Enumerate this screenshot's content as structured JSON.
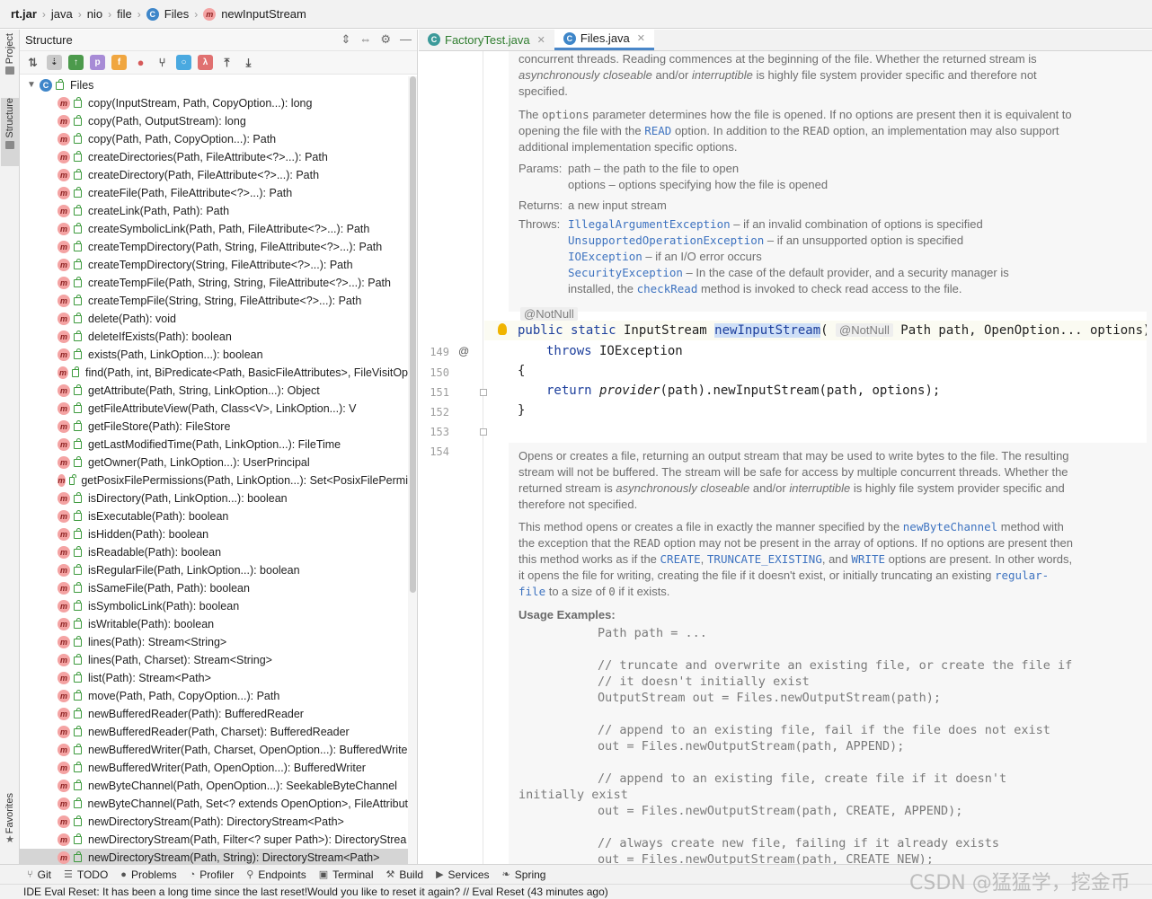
{
  "breadcrumb": [
    "rt.jar",
    "java",
    "nio",
    "file",
    "Files",
    "newInputStream"
  ],
  "left_stripe": {
    "project": "Project",
    "structure": "Structure",
    "favorites": "Favorites"
  },
  "structure": {
    "title": "Structure",
    "root": "Files",
    "members": [
      "copy(InputStream, Path, CopyOption...): long",
      "copy(Path, OutputStream): long",
      "copy(Path, Path, CopyOption...): Path",
      "createDirectories(Path, FileAttribute<?>...): Path",
      "createDirectory(Path, FileAttribute<?>...): Path",
      "createFile(Path, FileAttribute<?>...): Path",
      "createLink(Path, Path): Path",
      "createSymbolicLink(Path, Path, FileAttribute<?>...): Path",
      "createTempDirectory(Path, String, FileAttribute<?>...): Path",
      "createTempDirectory(String, FileAttribute<?>...): Path",
      "createTempFile(Path, String, String, FileAttribute<?>...): Path",
      "createTempFile(String, String, FileAttribute<?>...): Path",
      "delete(Path): void",
      "deleteIfExists(Path): boolean",
      "exists(Path, LinkOption...): boolean",
      "find(Path, int, BiPredicate<Path, BasicFileAttributes>, FileVisitOp",
      "getAttribute(Path, String, LinkOption...): Object",
      "getFileAttributeView(Path, Class<V>, LinkOption...): V",
      "getFileStore(Path): FileStore",
      "getLastModifiedTime(Path, LinkOption...): FileTime",
      "getOwner(Path, LinkOption...): UserPrincipal",
      "getPosixFilePermissions(Path, LinkOption...): Set<PosixFilePermi",
      "isDirectory(Path, LinkOption...): boolean",
      "isExecutable(Path): boolean",
      "isHidden(Path): boolean",
      "isReadable(Path): boolean",
      "isRegularFile(Path, LinkOption...): boolean",
      "isSameFile(Path, Path): boolean",
      "isSymbolicLink(Path): boolean",
      "isWritable(Path): boolean",
      "lines(Path): Stream<String>",
      "lines(Path, Charset): Stream<String>",
      "list(Path): Stream<Path>",
      "move(Path, Path, CopyOption...): Path",
      "newBufferedReader(Path): BufferedReader",
      "newBufferedReader(Path, Charset): BufferedReader",
      "newBufferedWriter(Path, Charset, OpenOption...): BufferedWrite",
      "newBufferedWriter(Path, OpenOption...): BufferedWriter",
      "newByteChannel(Path, OpenOption...): SeekableByteChannel",
      "newByteChannel(Path, Set<? extends OpenOption>, FileAttribut",
      "newDirectoryStream(Path): DirectoryStream<Path>",
      "newDirectoryStream(Path, Filter<? super Path>): DirectoryStrea",
      "newDirectoryStream(Path, String): DirectoryStream<Path>"
    ]
  },
  "editor": {
    "tabs": [
      {
        "name": "FactoryTest.java",
        "active": false
      },
      {
        "name": "Files.java",
        "active": true
      }
    ],
    "doc_top": {
      "p1_a": "concurrent threads. Reading commences at the beginning of the file. Whether the returned stream is ",
      "p1_it1": "asynchronously closeable",
      "p1_b": " and/or ",
      "p1_it2": "interruptible",
      "p1_c": " is highly file system provider specific and therefore not specified.",
      "p2_a": "The ",
      "p2_code": "options",
      "p2_b": " parameter determines how the file is opened. If no options are present then it is equivalent to opening the file with the ",
      "p2_link": "READ",
      "p2_c": " option. In addition to the ",
      "p2_code2": "READ",
      "p2_d": " option, an implementation may also support additional implementation specific options.",
      "params_label": "Params:",
      "param1": "path – the path to the file to open",
      "param2": "options – options specifying how the file is opened",
      "returns_label": "Returns:",
      "returns": "a new input stream",
      "throws_label": "Throws:",
      "throw1_ex": "IllegalArgumentException",
      "throw1_txt": " – if an invalid combination of options is specified",
      "throw2_ex": "UnsupportedOperationException",
      "throw2_txt": " – if an unsupported option is specified",
      "throw3_ex": "IOException",
      "throw3_txt": " – if an I/O error occurs",
      "throw4_ex": "SecurityException",
      "throw4_txt": " – In the case of the default provider, and a security manager is",
      "throw4_cont_a": "installed, the ",
      "throw4_link": "checkRead",
      "throw4_cont_b": " method is invoked to check read access to the file."
    },
    "annotation": "@NotNull",
    "line_numbers": [
      "149",
      "150",
      "151",
      "152",
      "153",
      "154"
    ],
    "code": {
      "l149_a": "public static",
      "l149_b": " InputStream ",
      "l149_c": "newInputStream",
      "l149_d": "( ",
      "l149_anno": "@NotNull",
      "l149_e": " Path path, OpenOption... options)",
      "l150_kw": "throws",
      "l150_b": " IOException",
      "l151": "{",
      "l152_kw": "return",
      "l152_it": "provider",
      "l152_b": "(path).newInputStream(path, options);",
      "l153": "}"
    },
    "doc_bottom": {
      "p1_a": "Opens or creates a file, returning an output stream that may be used to write bytes to the file. The resulting stream will not be buffered. The stream will be safe for access by multiple concurrent threads. Whether the returned stream is ",
      "p1_it1": "asynchronously closeable",
      "p1_b": " and/or ",
      "p1_it2": "interruptible",
      "p1_c": " is highly file system provider specific and therefore not specified.",
      "p2_a": "This method opens or creates a file in exactly the manner specified by the ",
      "p2_link1": "newByteChannel",
      "p2_b": " method with the exception that the ",
      "p2_code1": "READ",
      "p2_c": " option may not be present in the array of options. If no options are present then this method works as if the ",
      "p2_link2": "CREATE",
      "p2_d": ", ",
      "p2_link3": "TRUNCATE_EXISTING",
      "p2_e": ", and ",
      "p2_link4": "WRITE",
      "p2_f": " options are present. In other words, it opens the file for writing, creating the file if it doesn't exist, or initially truncating an existing ",
      "p2_link5": "regular-file",
      "p2_g": " to a size of ",
      "p2_code2": "0",
      "p2_h": " if it exists.",
      "usage_title": "Usage Examples:",
      "usage_lines": [
        "Path path = ...",
        "",
        "// truncate and overwrite an existing file, or create the file if",
        "// it doesn't initially exist",
        "OutputStream out = Files.newOutputStream(path);",
        "",
        "// append to an existing file, fail if the file does not exist",
        "out = Files.newOutputStream(path, APPEND);",
        "",
        "// append to an existing file, create file if it doesn't",
        "initially exist",
        "out = Files.newOutputStream(path, CREATE, APPEND);",
        "",
        "// always create new file, failing if it already exists",
        "out = Files.newOutputStream(path, CREATE_NEW);"
      ]
    }
  },
  "bottom_tools": [
    "Git",
    "TODO",
    "Problems",
    "Profiler",
    "Endpoints",
    "Terminal",
    "Build",
    "Services",
    "Spring"
  ],
  "status": "IDE Eval Reset: It has been a long time since the last reset!Would you like to reset it again? // Eval Reset (43 minutes ago)",
  "watermark": "CSDN @猛猛学，挖金币"
}
